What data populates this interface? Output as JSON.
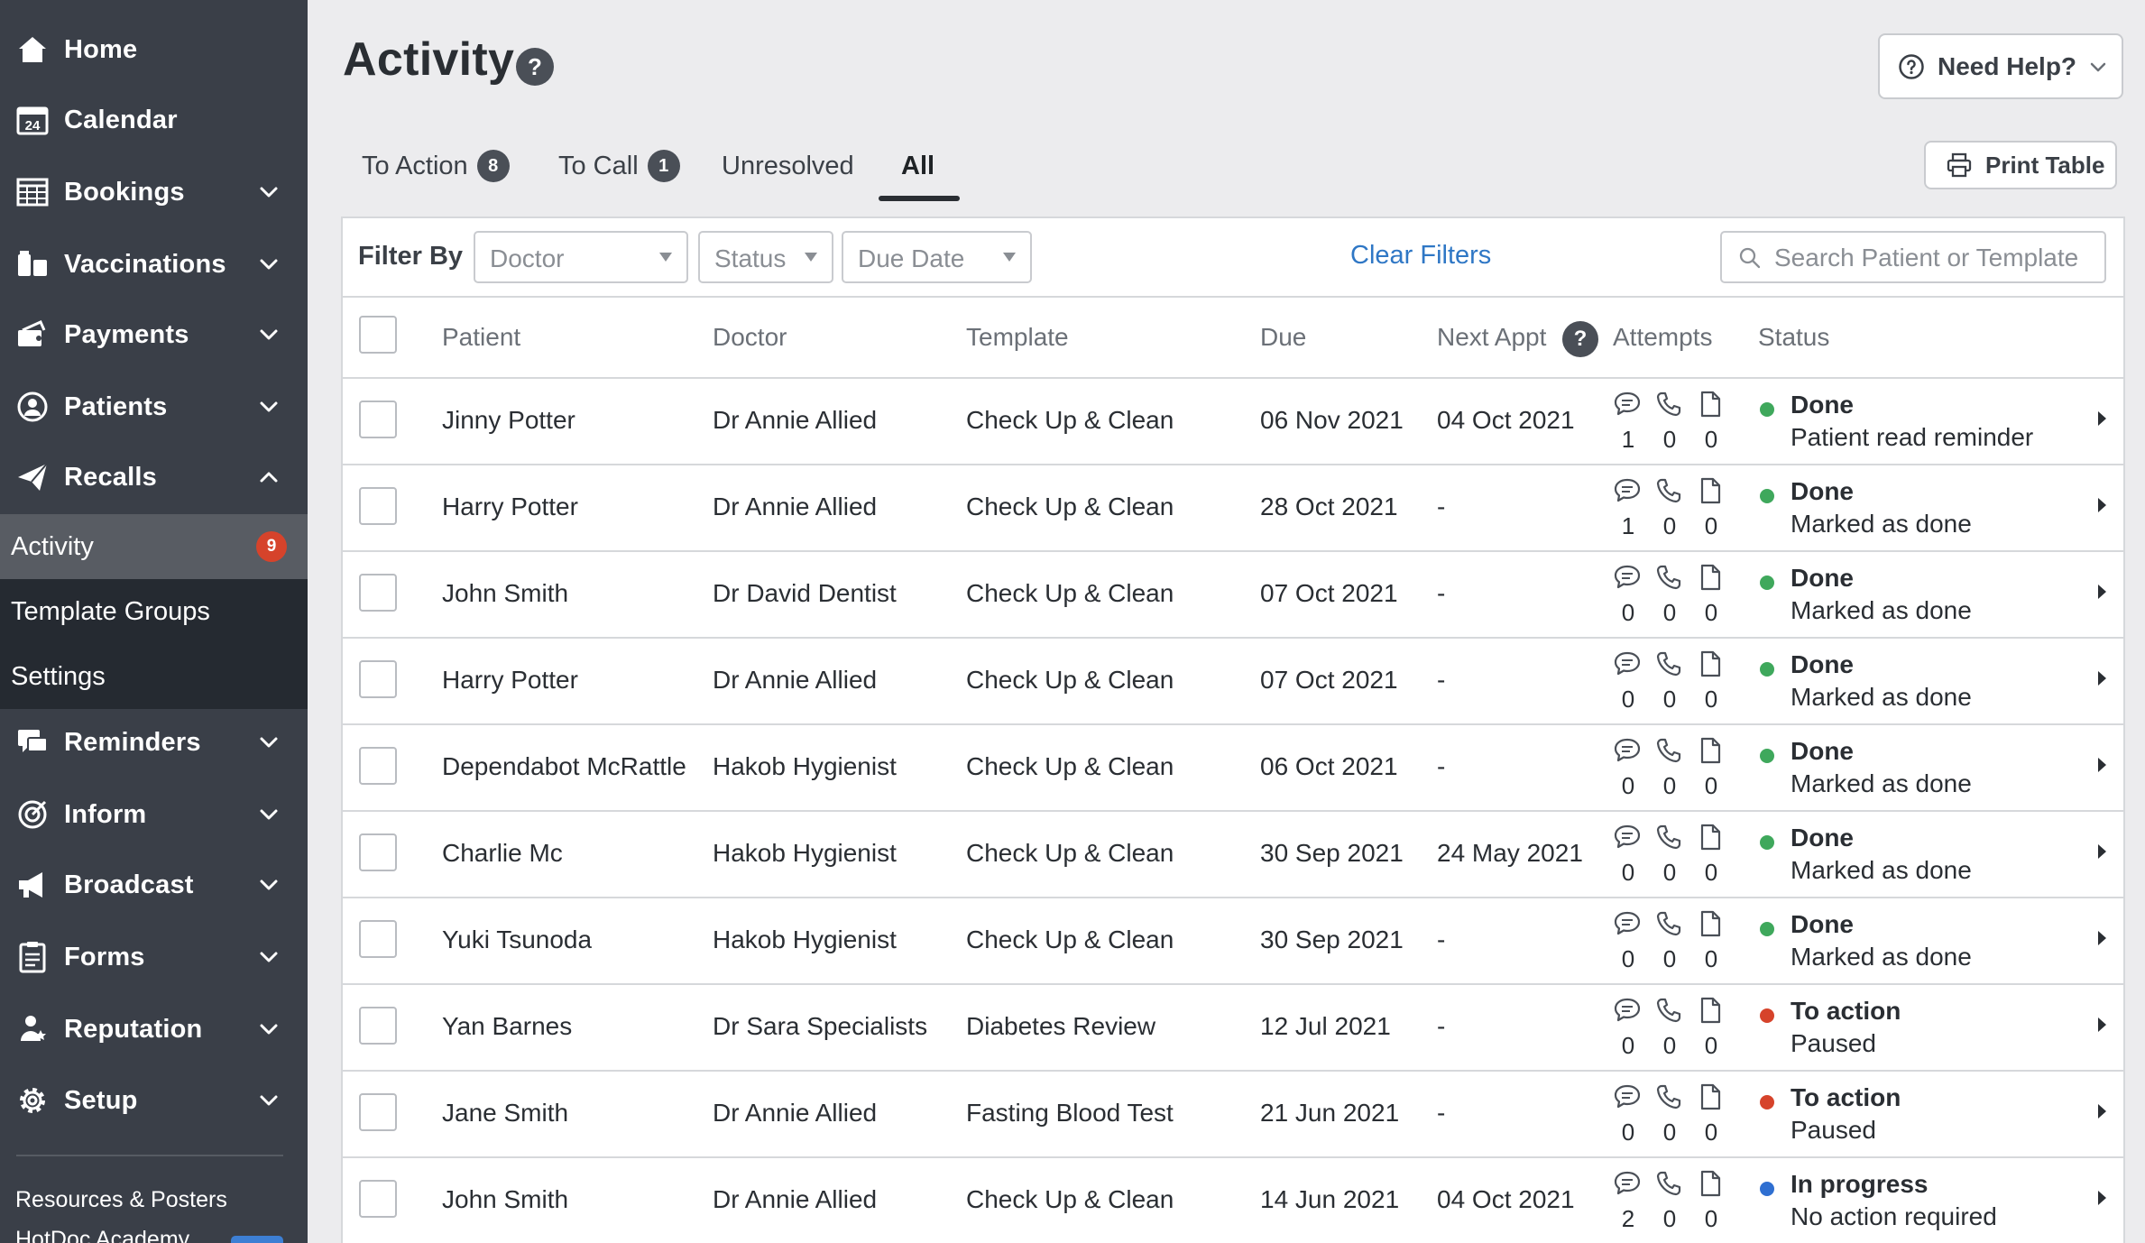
{
  "sidebar": {
    "items": [
      {
        "label": "Home",
        "icon": "home-icon"
      },
      {
        "label": "Calendar",
        "icon": "calendar-icon",
        "icon_text": "24"
      },
      {
        "label": "Bookings",
        "icon": "bookings-grid-icon"
      },
      {
        "label": "Vaccinations",
        "icon": "vaccinations-icon"
      },
      {
        "label": "Payments",
        "icon": "payments-icon"
      },
      {
        "label": "Patients",
        "icon": "patients-icon"
      },
      {
        "label": "Recalls",
        "icon": "recalls-paper-plane-icon"
      },
      {
        "label": "Reminders",
        "icon": "reminders-chat-icon"
      },
      {
        "label": "Inform",
        "icon": "inform-icon"
      },
      {
        "label": "Broadcast",
        "icon": "broadcast-megaphone-icon"
      },
      {
        "label": "Forms",
        "icon": "forms-icon"
      },
      {
        "label": "Reputation",
        "icon": "reputation-icon"
      },
      {
        "label": "Setup",
        "icon": "setup-gear-icon"
      }
    ],
    "recalls_sub": [
      {
        "label": "Activity",
        "badge": "9",
        "active": true
      },
      {
        "label": "Template Groups"
      },
      {
        "label": "Settings"
      }
    ],
    "footer_link": "Resources & Posters",
    "footer_link2": "HotDoc Academy"
  },
  "header": {
    "title": "Activity",
    "help_glyph": "?",
    "need_help_label": "Need Help?",
    "print_label": "Print Table"
  },
  "tabs": [
    {
      "label": "To Action",
      "count": "8"
    },
    {
      "label": "To Call",
      "count": "1"
    },
    {
      "label": "Unresolved"
    },
    {
      "label": "All",
      "active": true
    }
  ],
  "filters": {
    "label": "Filter By",
    "doctor": "Doctor",
    "status": "Status",
    "due_date": "Due Date",
    "clear_label": "Clear Filters",
    "search_placeholder": "Search Patient or Template"
  },
  "table": {
    "columns": {
      "patient": "Patient",
      "doctor": "Doctor",
      "template": "Template",
      "due": "Due",
      "next_appt": "Next Appt",
      "next_appt_help": "?",
      "attempts": "Attempts",
      "status": "Status"
    },
    "rows": [
      {
        "patient": "Jinny Potter",
        "doctor": "Dr Annie Allied",
        "template": "Check Up & Clean",
        "due": "06 Nov 2021",
        "next_appt": "04 Oct 2021",
        "sms": "1",
        "calls": "0",
        "letters": "0",
        "status": "Done",
        "status_color": "#3fa85c",
        "status_detail": "Patient read reminder"
      },
      {
        "patient": "Harry Potter",
        "doctor": "Dr Annie Allied",
        "template": "Check Up & Clean",
        "due": "28 Oct 2021",
        "next_appt": "-",
        "sms": "1",
        "calls": "0",
        "letters": "0",
        "status": "Done",
        "status_color": "#3fa85c",
        "status_detail": "Marked as done"
      },
      {
        "patient": "John Smith",
        "doctor": "Dr David Dentist",
        "template": "Check Up & Clean",
        "due": "07 Oct 2021",
        "next_appt": "-",
        "sms": "0",
        "calls": "0",
        "letters": "0",
        "status": "Done",
        "status_color": "#3fa85c",
        "status_detail": "Marked as done"
      },
      {
        "patient": "Harry Potter",
        "doctor": "Dr Annie Allied",
        "template": "Check Up & Clean",
        "due": "07 Oct 2021",
        "next_appt": "-",
        "sms": "0",
        "calls": "0",
        "letters": "0",
        "status": "Done",
        "status_color": "#3fa85c",
        "status_detail": "Marked as done"
      },
      {
        "patient": "Dependabot McRattle",
        "doctor": "Hakob Hygienist",
        "template": "Check Up & Clean",
        "due": "06 Oct 2021",
        "next_appt": "-",
        "sms": "0",
        "calls": "0",
        "letters": "0",
        "status": "Done",
        "status_color": "#3fa85c",
        "status_detail": "Marked as done"
      },
      {
        "patient": "Charlie Mc",
        "doctor": "Hakob Hygienist",
        "template": "Check Up & Clean",
        "due": "30 Sep 2021",
        "next_appt": "24 May 2021",
        "sms": "0",
        "calls": "0",
        "letters": "0",
        "status": "Done",
        "status_color": "#3fa85c",
        "status_detail": "Marked as done"
      },
      {
        "patient": "Yuki Tsunoda",
        "doctor": "Hakob Hygienist",
        "template": "Check Up & Clean",
        "due": "30 Sep 2021",
        "next_appt": "-",
        "sms": "0",
        "calls": "0",
        "letters": "0",
        "status": "Done",
        "status_color": "#3fa85c",
        "status_detail": "Marked as done"
      },
      {
        "patient": "Yan Barnes",
        "doctor": "Dr Sara Specialists",
        "template": "Diabetes Review",
        "due": "12 Jul 2021",
        "next_appt": "-",
        "sms": "0",
        "calls": "0",
        "letters": "0",
        "status": "To action",
        "status_color": "#d6432b",
        "status_detail": "Paused"
      },
      {
        "patient": "Jane Smith",
        "doctor": "Dr Annie Allied",
        "template": "Fasting Blood Test",
        "due": "21 Jun 2021",
        "next_appt": "-",
        "sms": "0",
        "calls": "0",
        "letters": "0",
        "status": "To action",
        "status_color": "#d6432b",
        "status_detail": "Paused"
      },
      {
        "patient": "John Smith",
        "doctor": "Dr Annie Allied",
        "template": "Check Up & Clean",
        "due": "14 Jun 2021",
        "next_appt": "04 Oct 2021",
        "sms": "2",
        "calls": "0",
        "letters": "0",
        "status": "In progress",
        "status_color": "#2f6fd1",
        "status_detail": "No action required"
      }
    ]
  },
  "colors": {
    "sidebar_bg": "#3a3f48",
    "subnav_bg": "#252a31",
    "active_sub_bg": "#585c63",
    "badge_red": "#d6432b",
    "link_blue": "#2f77c5",
    "done_green": "#3fa85c",
    "action_red": "#d6432b",
    "progress_blue": "#2f6fd1"
  }
}
